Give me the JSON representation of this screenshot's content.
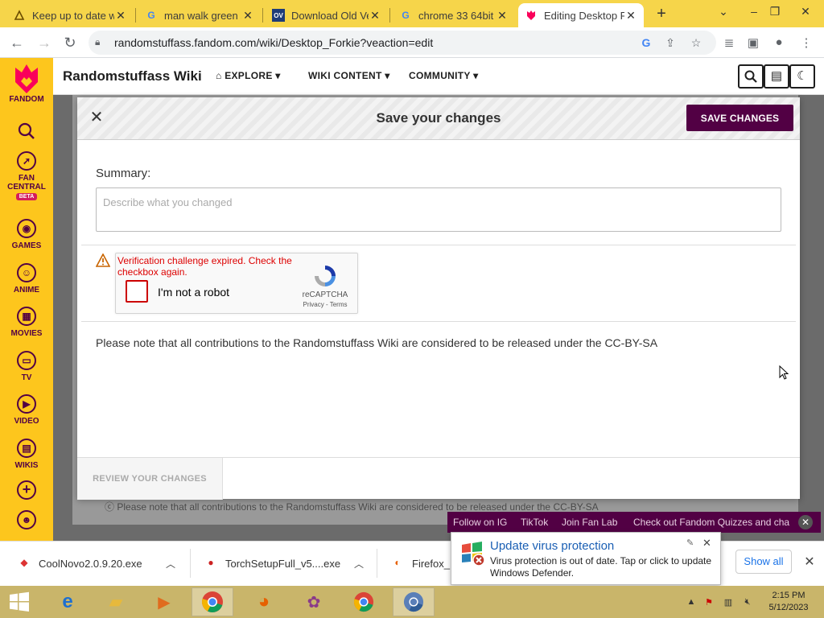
{
  "browser": {
    "tabs": [
      {
        "title": "Keep up to date w",
        "icon": "fandom-tab-icon"
      },
      {
        "title": "man walk green s",
        "icon": "google-icon"
      },
      {
        "title": "Download Old Ve",
        "icon": "oldversion-icon"
      },
      {
        "title": "chrome 33 64bit v",
        "icon": "google-icon"
      },
      {
        "title": "Editing Desktop F",
        "icon": "fandom-icon"
      }
    ],
    "url": "randomstuffass.fandom.com/wiki/Desktop_Forkie?veaction=edit"
  },
  "rail": {
    "brand": "FANDOM",
    "items": [
      {
        "label": "FAN CENTRAL",
        "badge": "BETA"
      },
      {
        "label": "GAMES"
      },
      {
        "label": "ANIME"
      },
      {
        "label": "MOVIES"
      },
      {
        "label": "TV"
      },
      {
        "label": "VIDEO"
      },
      {
        "label": "WIKIS"
      }
    ]
  },
  "wiki": {
    "name": "Randomstuffass Wiki",
    "nav": [
      "EXPLORE",
      "WIKI CONTENT",
      "COMMUNITY"
    ]
  },
  "dialog": {
    "title": "Save your changes",
    "save_label": "SAVE CHANGES",
    "summary_label": "Summary:",
    "summary_placeholder": "Describe what you changed",
    "recaptcha": {
      "error": "Verification challenge expired. Check the checkbox again.",
      "checkbox_label": "I'm not a robot",
      "brand": "reCAPTCHA",
      "links": "Privacy - Terms"
    },
    "license_note": "Please note that all contributions to the Randomstuffass Wiki are considered to be released under the CC-BY-SA",
    "review_label": "REVIEW YOUR CHANGES"
  },
  "background": {
    "license_note": "Please note that all contributions to the Randomstuffass Wiki are considered to be released under the CC-BY-SA",
    "footer_links": [
      "Follow on IG",
      "TikTok",
      "Join Fan Lab",
      "Check out Fandom Quizzes and cha"
    ]
  },
  "downloads": {
    "items": [
      "CoolNovo2.0.9.20.exe",
      "TorchSetupFull_v5....exe",
      "Firefox_"
    ],
    "show_all": "Show all"
  },
  "toast": {
    "title": "Update virus protection",
    "body": "Virus protection is out of date. Tap or click to update Windows Defender."
  },
  "clock": {
    "time": "2:15 PM",
    "date": "5/12/2023"
  },
  "colors": {
    "fandom_yellow": "#fdc61d",
    "fandom_purple": "#520044",
    "error_red": "#d00000"
  }
}
